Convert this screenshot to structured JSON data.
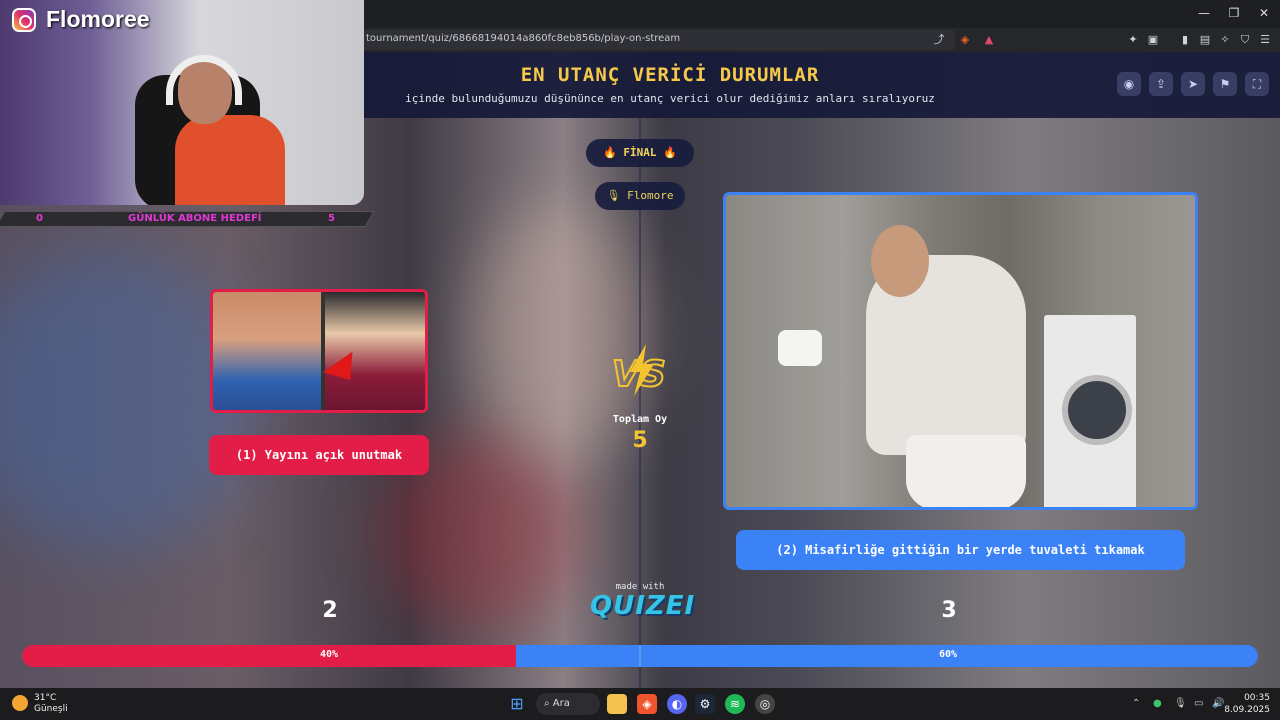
{
  "browser": {
    "url": "tournament/quiz/68668194014a860fc8eb856b/play-on-stream",
    "window_controls": [
      "—",
      "❐",
      "✕"
    ]
  },
  "quiz": {
    "title": "EN UTANÇ VERİCİ DURUMLAR",
    "subtitle": "içinde bulunduğumuzu düşününce en utanç verici olur dediğimiz anları sıralıyoruz",
    "round_label": "🔥 FİNAL 🔥",
    "host_label": "🎙 Flomore",
    "vs_text": "VS",
    "total_votes_label": "Toplam Oy",
    "total_votes_value": "5",
    "made_with": "made with",
    "brand_logo": "QUIZEI",
    "left_option": {
      "label": "(1) Yayını açık unutmak",
      "votes": "2",
      "percent": 40,
      "percent_label": "40%",
      "color": "#e11d48"
    },
    "right_option": {
      "label": "(2) Misafirliğe gittiğin bir yerde tuvaleti tıkamak",
      "votes": "3",
      "percent": 60,
      "percent_label": "60%",
      "color": "#3b82f6"
    }
  },
  "header_actions": [
    "eye-icon",
    "share-icon",
    "send-icon",
    "flag-icon",
    "fullscreen-icon"
  ],
  "stream_overlay": {
    "brand": "Flomoree",
    "goal_left": "0",
    "goal_label": "GÜNLÜK ABONE HEDEFİ",
    "goal_right": "5"
  },
  "taskbar": {
    "weather_temp": "31°C",
    "weather_desc": "Güneşli",
    "search": "Ara",
    "time": "00:35",
    "date": "8.09.2025"
  }
}
